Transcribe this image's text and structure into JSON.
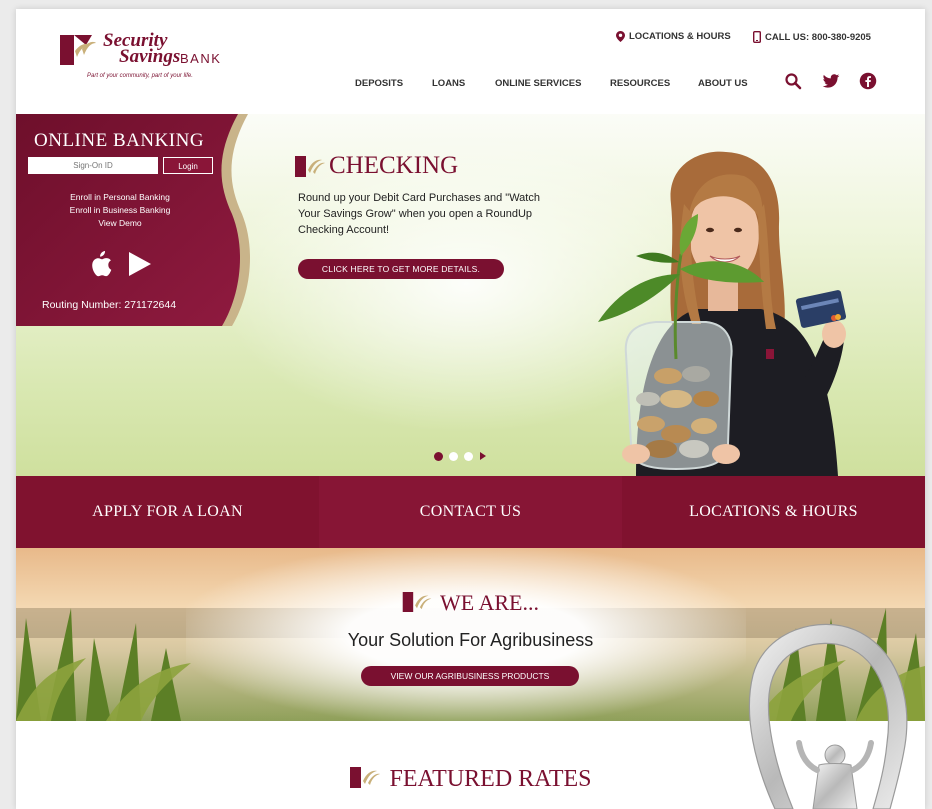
{
  "brand": {
    "name_line1": "Security",
    "name_line2": "Savings",
    "name_suffix": "BANK",
    "tagline": "Part of your community, part of your life.",
    "color": "#7a1030"
  },
  "utility": {
    "locations": "LOCATIONS & HOURS",
    "call": "CALL US: 800-380-9205"
  },
  "nav": {
    "items": [
      "DEPOSITS",
      "LOANS",
      "ONLINE SERVICES",
      "RESOURCES",
      "ABOUT US"
    ],
    "icons": [
      "search-icon",
      "twitter-icon",
      "facebook-icon"
    ]
  },
  "online_banking": {
    "title": "ONLINE BANKING",
    "signon_placeholder": "Sign-On ID",
    "login_label": "Login",
    "links": [
      "Enroll in Personal Banking",
      "Enroll in Business Banking",
      "View Demo"
    ],
    "app_icons": [
      "apple-icon",
      "google-play-icon"
    ],
    "routing": "Routing Number: 271172644"
  },
  "hero": {
    "title": "CHECKING",
    "text": "Round up your Debit Card Purchases and \"Watch Your Savings Grow\" when you open a RoundUp Checking Account!",
    "button": "CLICK HERE TO GET MORE DETAILS.",
    "slides": 3,
    "active_slide": 1
  },
  "cta": [
    "APPLY FOR A LOAN",
    "CONTACT US",
    "LOCATIONS & HOURS"
  ],
  "agri": {
    "title": "WE ARE...",
    "subtitle": "Your Solution For Agribusiness",
    "button": "VIEW OUR AGRIBUSINESS PRODUCTS"
  },
  "featured": {
    "title": "FEATURED RATES"
  }
}
